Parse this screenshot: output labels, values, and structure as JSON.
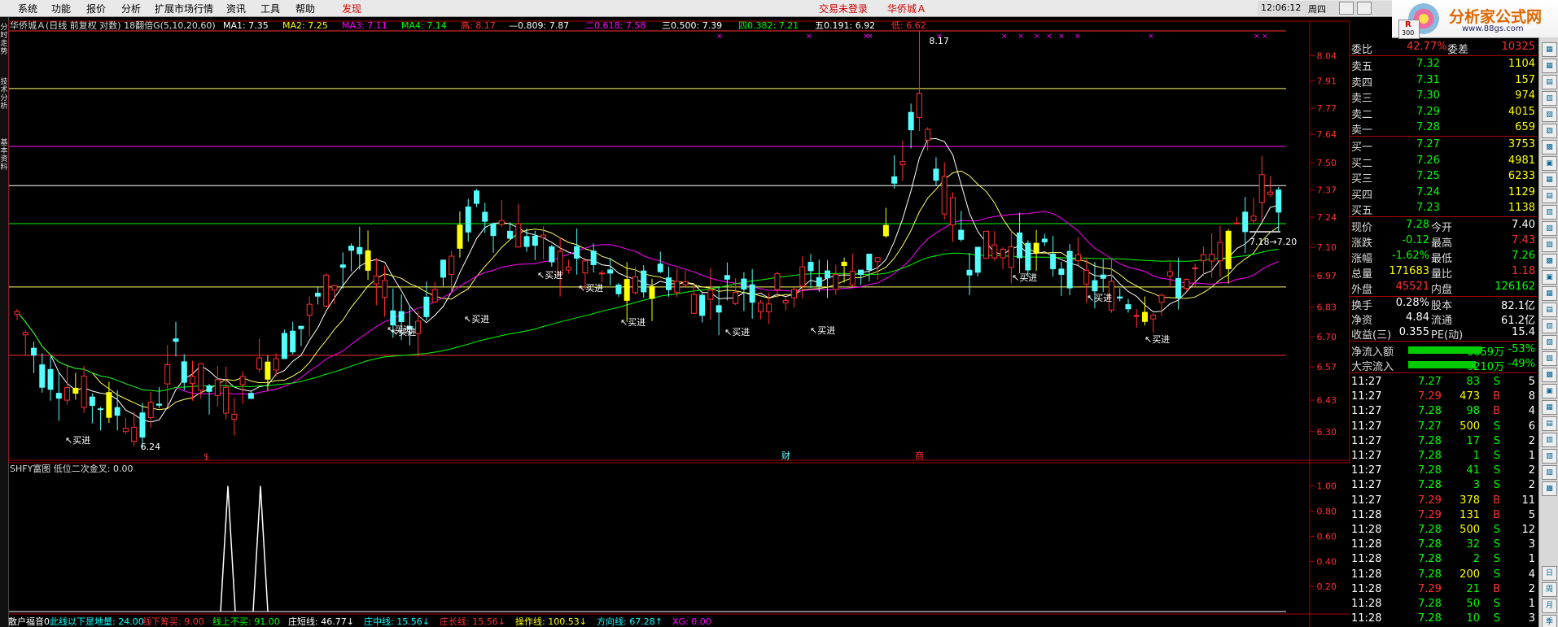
{
  "menubar": {
    "items": [
      "系统",
      "功能",
      "报价",
      "分析",
      "扩展市场行情",
      "资讯",
      "工具",
      "帮助",
      "发现"
    ],
    "trade_status": "交易未登录",
    "stock_name": "华侨城Ａ",
    "clock": "12:06:12",
    "period": "周四",
    "r_badge": "R",
    "r_badge_num": "300"
  },
  "logo": {
    "title": "分析家公式网",
    "url": "www.88gs.com"
  },
  "left_tabs": [
    "分时走势",
    "技术分析",
    "基本资料"
  ],
  "chart_header": {
    "name": "华侨城Ａ(日线 前复权 对数) 18翻倍G(5,10,20,60)",
    "items": [
      {
        "label": "MA1: 7.35",
        "color": "#ffffff"
      },
      {
        "label": "MA2: 7.25",
        "color": "#ffff00"
      },
      {
        "label": "MA3: 7.11",
        "color": "#ff00ff"
      },
      {
        "label": "MA4: 7.14",
        "color": "#00ff00"
      },
      {
        "label": "高: 8.17",
        "color": "#ff3030"
      },
      {
        "label": "—0.809: 7.87",
        "color": "#ffffff"
      },
      {
        "label": "二0.618: 7.58",
        "color": "#ff00ff"
      },
      {
        "label": "三0.500: 7.39",
        "color": "#ffffff"
      },
      {
        "label": "四0.382: 7.21",
        "color": "#00ff00"
      },
      {
        "label": "五0.191: 6.92",
        "color": "#ffffff"
      },
      {
        "label": "低: 6.62",
        "color": "#ff3030"
      }
    ]
  },
  "indicator_header": "SHFY富图  低位二次金叉: 0.00",
  "bottom_bar": [
    {
      "label": "散户福音0",
      "color": "#ffffff"
    },
    {
      "label": "此线以下是地量: 24.00",
      "color": "#00ffff"
    },
    {
      "label": "线下筹买: 9.00",
      "color": "#ff3030"
    },
    {
      "label": "线上不买: 91.00",
      "color": "#00ff00"
    },
    {
      "label": "庄短线: 46.77↓",
      "color": "#ffffff"
    },
    {
      "label": "庄中线: 15.56↓",
      "color": "#00ffff"
    },
    {
      "label": "庄长线: 15.56↓",
      "color": "#ff3030"
    },
    {
      "label": "操作线: 100.53↓",
      "color": "#ffff00"
    },
    {
      "label": "方向线: 67.28↑",
      "color": "#00ffff"
    },
    {
      "label": "XG: 0.00",
      "color": "#ff00ff"
    }
  ],
  "quote": {
    "weibi": {
      "label": "委比",
      "value": "42.77%",
      "label2": "委差",
      "value2": "10325"
    },
    "sells": [
      {
        "label": "卖五",
        "price": "7.32",
        "vol": "1104"
      },
      {
        "label": "卖四",
        "price": "7.31",
        "vol": "157"
      },
      {
        "label": "卖三",
        "price": "7.30",
        "vol": "974"
      },
      {
        "label": "卖二",
        "price": "7.29",
        "vol": "4015"
      },
      {
        "label": "卖一",
        "price": "7.28",
        "vol": "659"
      }
    ],
    "buys": [
      {
        "label": "买一",
        "price": "7.27",
        "vol": "3753"
      },
      {
        "label": "买二",
        "price": "7.26",
        "vol": "4981"
      },
      {
        "label": "买三",
        "price": "7.25",
        "vol": "6233"
      },
      {
        "label": "买四",
        "price": "7.24",
        "vol": "1129"
      },
      {
        "label": "买五",
        "price": "7.23",
        "vol": "1138"
      }
    ],
    "stats": [
      {
        "l1": "现价",
        "v1": "7.28",
        "c1": "#00ff00",
        "l2": "今开",
        "v2": "7.40",
        "c2": "#ffffff"
      },
      {
        "l1": "涨跌",
        "v1": "-0.12",
        "c1": "#00ff00",
        "l2": "最高",
        "v2": "7.43",
        "c2": "#ff3030"
      },
      {
        "l1": "涨幅",
        "v1": "-1.62%",
        "c1": "#00ff00",
        "l2": "最低",
        "v2": "7.26",
        "c2": "#00ff00"
      },
      {
        "l1": "总量",
        "v1": "171683",
        "c1": "#ffff00",
        "l2": "量比",
        "v2": "1.18",
        "c2": "#ff3030"
      },
      {
        "l1": "外盘",
        "v1": "45521",
        "c1": "#ff3030",
        "l2": "内盘",
        "v2": "126162",
        "c2": "#00ff00"
      }
    ],
    "stats2": [
      {
        "l1": "换手",
        "v1": "0.28%",
        "l2": "股本",
        "v2": "82.1亿"
      },
      {
        "l1": "净资",
        "v1": "4.84",
        "l2": "流通",
        "v2": "61.2亿"
      },
      {
        "l1": "收益(三)",
        "v1": "0.355",
        "l2": "PE(动)",
        "v2": "15.4"
      }
    ],
    "flows": [
      {
        "label": "净流入额",
        "value": "-6659万",
        "pct": "-53%",
        "bar": 0.53
      },
      {
        "label": "大宗流入",
        "value": "-6210万",
        "pct": "-49%",
        "bar": 0.49
      }
    ],
    "ticks": [
      [
        "11:27",
        "7.27",
        "83",
        "S",
        "5"
      ],
      [
        "11:27",
        "7.29",
        "473",
        "B",
        "8"
      ],
      [
        "11:27",
        "7.28",
        "98",
        "B",
        "4"
      ],
      [
        "11:27",
        "7.27",
        "500",
        "S",
        "6"
      ],
      [
        "11:27",
        "7.28",
        "17",
        "S",
        "2"
      ],
      [
        "11:27",
        "7.28",
        "1",
        "S",
        "1"
      ],
      [
        "11:27",
        "7.28",
        "41",
        "S",
        "2"
      ],
      [
        "11:27",
        "7.28",
        "3",
        "S",
        "2"
      ],
      [
        "11:27",
        "7.29",
        "378",
        "B",
        "11"
      ],
      [
        "11:28",
        "7.29",
        "131",
        "B",
        "5"
      ],
      [
        "11:28",
        "7.28",
        "500",
        "S",
        "12"
      ],
      [
        "11:28",
        "7.28",
        "32",
        "S",
        "3"
      ],
      [
        "11:28",
        "7.28",
        "2",
        "S",
        "1"
      ],
      [
        "11:28",
        "7.28",
        "200",
        "S",
        "4"
      ],
      [
        "11:28",
        "7.29",
        "21",
        "B",
        "2"
      ],
      [
        "11:28",
        "7.28",
        "50",
        "S",
        "1"
      ],
      [
        "11:28",
        "7.28",
        "10",
        "S",
        "3"
      ]
    ]
  },
  "side_buttons": [
    "日",
    "周",
    "月",
    "季"
  ],
  "chart_data": [
    {
      "type": "candlestick",
      "title": "华侨城Ａ(日线 前复权 对数) 18翻倍G(5,10,20,60)",
      "y_ticks": [
        8.04,
        7.91,
        7.77,
        7.64,
        7.5,
        7.37,
        7.24,
        7.1,
        6.97,
        6.83,
        6.7,
        6.57,
        6.43,
        6.3
      ],
      "ylim": [
        6.22,
        8.17
      ],
      "horizontal_levels": [
        {
          "value": 8.17,
          "color": "#ff3030"
        },
        {
          "value": 7.87,
          "color": "#ffff66"
        },
        {
          "value": 7.58,
          "color": "#ff00ff"
        },
        {
          "value": 7.39,
          "color": "#ffffff"
        },
        {
          "value": 7.21,
          "color": "#00ff00"
        },
        {
          "value": 6.92,
          "color": "#ffff66"
        },
        {
          "value": 6.62,
          "color": "#ff3030"
        }
      ],
      "annotations": [
        {
          "text": "8.17"
        },
        {
          "text": "6.24"
        },
        {
          "text": "7.18→7.20"
        }
      ],
      "buy_signals": [
        "买进",
        "买进",
        "买进",
        "买进",
        "买进",
        "买进",
        "买进",
        "买进",
        "买进",
        "买进",
        "买进",
        "买进"
      ],
      "event_markers": [
        "$",
        "财",
        "商"
      ],
      "ma_legend": [
        "MA1: 7.35",
        "MA2: 7.25",
        "MA3: 7.11",
        "MA4: 7.14"
      ]
    },
    {
      "type": "line",
      "title": "SHFY富图  低位二次金叉: 0.00",
      "y_ticks": [
        1.0,
        0.8,
        0.6,
        0.4,
        0.2
      ],
      "ylim": [
        0,
        1.05
      ],
      "series": [
        {
          "name": "低位二次金叉",
          "spikes": [
            1.0,
            1.0
          ]
        }
      ]
    }
  ]
}
